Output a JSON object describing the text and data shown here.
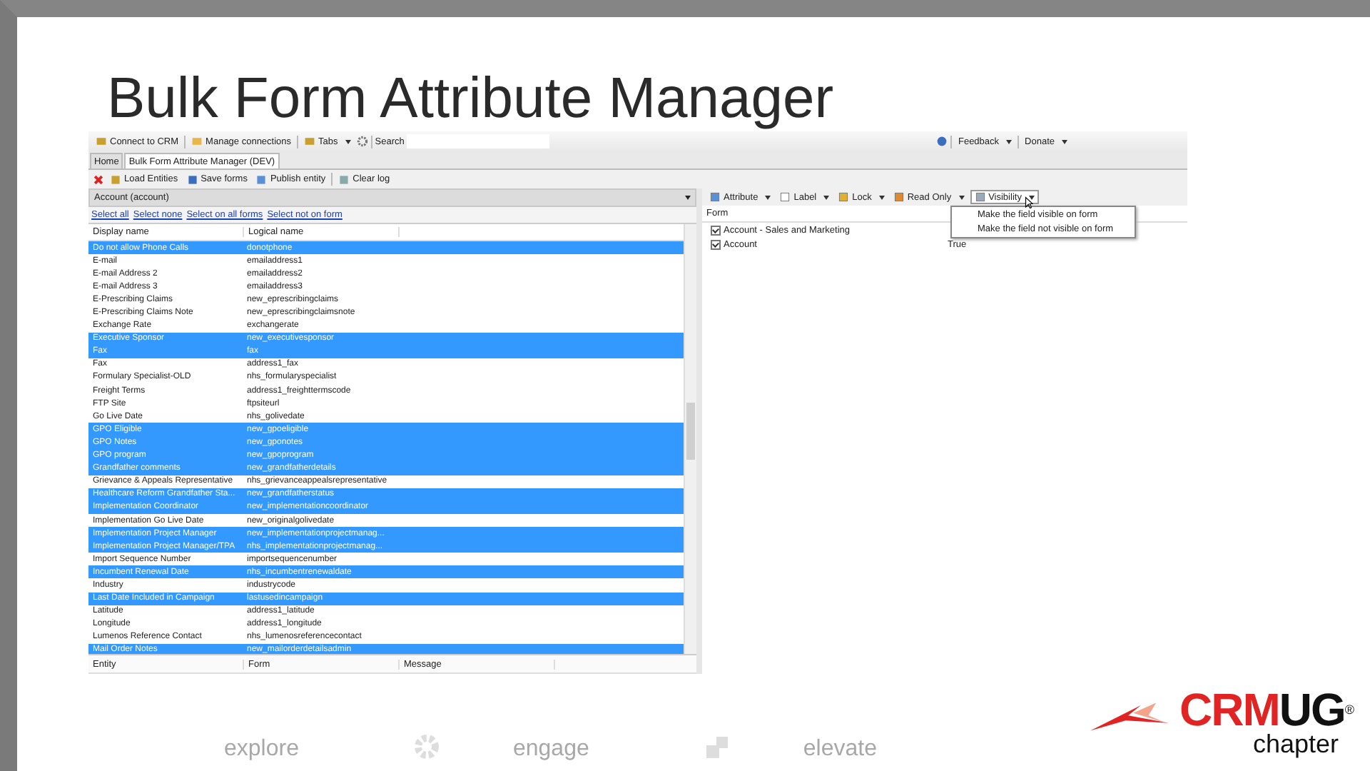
{
  "slide": {
    "title": "Bulk Form Attribute Manager"
  },
  "app": {
    "main_toolbar": [
      {
        "label": "Connect to CRM"
      },
      {
        "label": "Manage connections"
      },
      {
        "label": "Tabs"
      }
    ],
    "search": {
      "label": "Search"
    },
    "right_toolbar": [
      {
        "label": "Feedback"
      },
      {
        "label": "Donate"
      }
    ],
    "tabs": [
      {
        "label": "Home",
        "selected": false
      },
      {
        "label": "Bulk Form Attribute Manager (DEV)",
        "selected": true
      }
    ],
    "tool_toolbar": [
      {
        "label": "Load Entities"
      },
      {
        "label": "Save forms"
      },
      {
        "label": "Publish entity"
      },
      {
        "label": "Clear log"
      }
    ],
    "entity_select": {
      "value": "Account (account)"
    },
    "links": [
      "Select all",
      "Select none",
      "Select on all forms",
      "Select not on form"
    ],
    "attributes": {
      "columns": [
        "Display name",
        "Logical name"
      ],
      "rows": [
        {
          "display": "Do not allow Phone Calls",
          "logical": "donotphone",
          "selected": true
        },
        {
          "display": "E-mail",
          "logical": "emailaddress1",
          "selected": false
        },
        {
          "display": "E-mail Address 2",
          "logical": "emailaddress2",
          "selected": false
        },
        {
          "display": "E-mail Address 3",
          "logical": "emailaddress3",
          "selected": false
        },
        {
          "display": "E-Prescribing Claims",
          "logical": "new_eprescribingclaims",
          "selected": false
        },
        {
          "display": "E-Prescribing Claims Note",
          "logical": "new_eprescribingclaimsnote",
          "selected": false
        },
        {
          "display": "Exchange Rate",
          "logical": "exchangerate",
          "selected": false
        },
        {
          "display": "Executive Sponsor",
          "logical": "new_executivesponsor",
          "selected": true
        },
        {
          "display": "Fax",
          "logical": "fax",
          "selected": true
        },
        {
          "display": "Fax",
          "logical": "address1_fax",
          "selected": false
        },
        {
          "display": "Formulary Specialist-OLD",
          "logical": "nhs_formularyspecialist",
          "selected": false
        },
        {
          "display": "Freight Terms",
          "logical": "address1_freighttermscode",
          "selected": false
        },
        {
          "display": "FTP Site",
          "logical": "ftpsiteurl",
          "selected": false
        },
        {
          "display": "Go Live Date",
          "logical": "nhs_golivedate",
          "selected": false
        },
        {
          "display": "GPO Eligible",
          "logical": "new_gpoeligible",
          "selected": true
        },
        {
          "display": "GPO Notes",
          "logical": "new_gponotes",
          "selected": true
        },
        {
          "display": "GPO program",
          "logical": "new_gpoprogram",
          "selected": true
        },
        {
          "display": "Grandfather comments",
          "logical": "new_grandfatherdetails",
          "selected": true
        },
        {
          "display": "Grievance & Appeals Representative",
          "logical": "nhs_grievanceappealsrepresentative",
          "selected": false
        },
        {
          "display": "Healthcare Reform Grandfather Sta...",
          "logical": "new_grandfatherstatus",
          "selected": true
        },
        {
          "display": "Implementation Coordinator",
          "logical": "new_implementationcoordinator",
          "selected": true
        },
        {
          "display": "Implementation Go Live Date",
          "logical": "new_originalgolivedate",
          "selected": false
        },
        {
          "display": "Implementation Project Manager",
          "logical": "new_implementationprojectmanag...",
          "selected": true
        },
        {
          "display": "Implementation Project Manager/TPA",
          "logical": "nhs_implementationprojectmanag...",
          "selected": true
        },
        {
          "display": "Import Sequence Number",
          "logical": "importsequencenumber",
          "selected": false
        },
        {
          "display": "Incumbent Renewal Date",
          "logical": "nhs_incumbentrenewaldate",
          "selected": true
        },
        {
          "display": "Industry",
          "logical": "industrycode",
          "selected": false
        },
        {
          "display": "Last Date Included in Campaign",
          "logical": "lastusedincampaign",
          "selected": true
        },
        {
          "display": "Latitude",
          "logical": "address1_latitude",
          "selected": false
        },
        {
          "display": "Longitude",
          "logical": "address1_longitude",
          "selected": false
        },
        {
          "display": "Lumenos Reference Contact",
          "logical": "nhs_lumenosreferencecontact",
          "selected": false
        },
        {
          "display": "Mail Order Notes",
          "logical": "new_mailorderdetailsadmin",
          "selected": true
        }
      ]
    },
    "log": {
      "columns": [
        "Entity",
        "Form",
        "Message"
      ]
    },
    "form_toolbar": [
      {
        "label": "Attribute"
      },
      {
        "label": "Label"
      },
      {
        "label": "Lock"
      },
      {
        "label": "Read Only"
      },
      {
        "label": "Visibility"
      }
    ],
    "visibility_menu": [
      "Make the field visible on form",
      "Make the field not visible on form"
    ],
    "forms": {
      "columns": [
        "Form"
      ],
      "rows": [
        {
          "form": "Account - Sales and Marketing",
          "checked": true
        },
        {
          "form": "Account",
          "checked": true,
          "column_2": "True"
        }
      ]
    }
  },
  "footer": {
    "taglines": [
      "explore",
      "engage",
      "elevate"
    ],
    "logo": {
      "red": "CRM",
      "black": "UG",
      "mark": "®",
      "sub": "chapter"
    }
  }
}
